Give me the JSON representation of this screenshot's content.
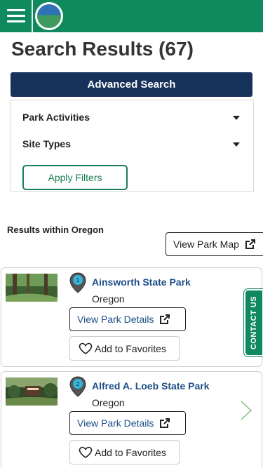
{
  "header": {
    "menu_icon": "hamburger-menu-icon",
    "logo_alt_text": "OREGON STATE PARKS",
    "colors": {
      "bar": "#0f8a5f"
    }
  },
  "page": {
    "title": "Search Results (67)"
  },
  "advanced_search": {
    "label": "Advanced Search"
  },
  "filters": {
    "park_activities": "Park Activities",
    "site_types": "Site Types",
    "apply": "Apply Filters"
  },
  "results": {
    "label": "Results within Oregon",
    "map_button": "View Park Map"
  },
  "parks": [
    {
      "number": "1",
      "name": "Ainsworth State Park",
      "state": "Oregon",
      "details": "View Park Details",
      "favorite": "Add to Favorites"
    },
    {
      "number": "2",
      "name": "Alfred A. Loeb State Park",
      "state": "Oregon",
      "details": "View Park Details",
      "favorite": "Add to Favorites"
    }
  ],
  "contact_tab": {
    "label": "CONTACT US"
  }
}
